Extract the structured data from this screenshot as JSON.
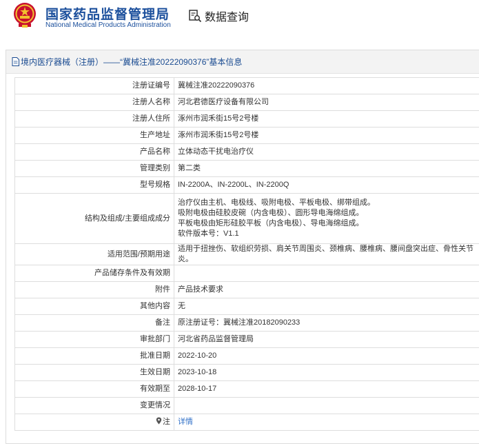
{
  "header": {
    "brand_cn": "国家药品监督管理局",
    "brand_en": "National Medical Products Administration",
    "query_label": "数据查询",
    "brand_color": "#1b4f9c"
  },
  "panel": {
    "title": "境内医疗器械（注册）——“冀械注准20222090376”基本信息"
  },
  "rows": [
    {
      "label": "注册证编号",
      "value": "冀械注准20222090376"
    },
    {
      "label": "注册人名称",
      "value": "河北君德医疗设备有限公司"
    },
    {
      "label": "注册人住所",
      "value": "涿州市润禾街15号2号楼"
    },
    {
      "label": "生产地址",
      "value": "涿州市润禾街15号2号楼"
    },
    {
      "label": "产品名称",
      "value": "立体动态干扰电治疗仪"
    },
    {
      "label": "管理类别",
      "value": "第二类"
    },
    {
      "label": "型号规格",
      "value": "IN-2200A、IN-2200L、IN-2200Q"
    },
    {
      "label": "结构及组成/主要组成成分",
      "lines": [
        "治疗仪由主机、电极线、吸附电极、平板电极、绑带组成。",
        "吸附电极由硅胶皮碗（内含电极）、圆形导电海绵组成。",
        "平板电极由矩形硅胶平板（内含电极）、导电海绵组成。",
        "软件版本号：V1.1"
      ]
    },
    {
      "label": "适用范围/预期用途",
      "value": "适用于扭挫伤、软组织劳损、肩关节周围炎、颈椎病、腰椎病、腰间盘突出症、骨性关节炎。"
    },
    {
      "label": "产品储存条件及有效期",
      "value": ""
    },
    {
      "label": "附件",
      "value": "产品技术要求"
    },
    {
      "label": "其他内容",
      "value": "无"
    },
    {
      "label": "备注",
      "value": "原注册证号：冀械注准20182090233"
    },
    {
      "label": "审批部门",
      "value": "河北省药品监督管理局"
    },
    {
      "label": "批准日期",
      "value": "2022-10-20"
    },
    {
      "label": "生效日期",
      "value": "2023-10-18"
    },
    {
      "label": "有效期至",
      "value": "2028-10-17"
    },
    {
      "label": "变更情况",
      "value": ""
    },
    {
      "label": "注",
      "value": "详情"
    }
  ]
}
